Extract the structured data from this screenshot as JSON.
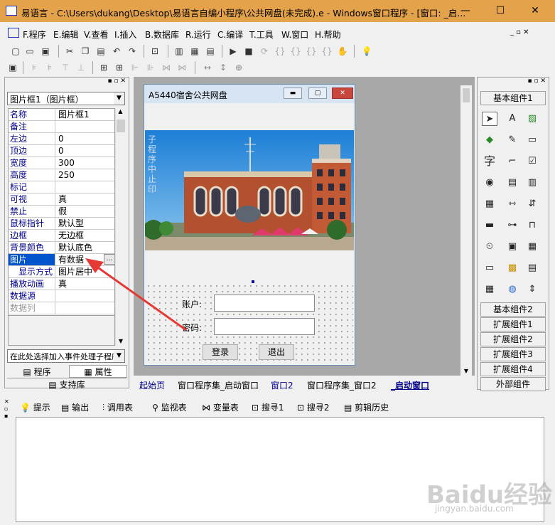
{
  "titlebar": {
    "title": "易语言 - C:\\Users\\dukang\\Desktop\\易语言自编小程序\\公共网盘(未完成).e - Windows窗口程序 - [窗口: _启...",
    "minimize": "—",
    "maximize": "☐",
    "close": "✕"
  },
  "menu": {
    "items": [
      {
        "label": "F.程序"
      },
      {
        "label": "E.编辑"
      },
      {
        "label": "V.查看"
      },
      {
        "label": "I.插入"
      },
      {
        "label": "B.数据库"
      },
      {
        "label": "R.运行"
      },
      {
        "label": "C.编译"
      },
      {
        "label": "T.工具"
      },
      {
        "label": "W.窗口"
      },
      {
        "label": "H.帮助"
      }
    ]
  },
  "left": {
    "object_selector": "图片框1（图片框）",
    "properties": [
      {
        "key": "名称",
        "value": "图片框1"
      },
      {
        "key": "备注",
        "value": ""
      },
      {
        "key": "左边",
        "value": "0"
      },
      {
        "key": "顶边",
        "value": "0"
      },
      {
        "key": "宽度",
        "value": "300"
      },
      {
        "key": "高度",
        "value": "250"
      },
      {
        "key": "标记",
        "value": ""
      },
      {
        "key": "可视",
        "value": "真"
      },
      {
        "key": "禁止",
        "value": "假"
      },
      {
        "key": "鼠标指针",
        "value": "默认型"
      },
      {
        "key": "边框",
        "value": "无边框"
      },
      {
        "key": "背景颜色",
        "value": "默认底色"
      },
      {
        "key": "图片",
        "value": "有数据"
      },
      {
        "key": "显示方式",
        "value": "图片居中"
      },
      {
        "key": "播放动画",
        "value": "真"
      },
      {
        "key": "数据源",
        "value": ""
      },
      {
        "key": "数据列",
        "value": ""
      }
    ],
    "event_selector": "在此处选择加入事件处理子程序",
    "tab_program": "程序",
    "tab_property": "属性",
    "tab_support": "支持库"
  },
  "form": {
    "title": "A5440宿舍公共网盘",
    "photo_text": "子程序中止印",
    "account_label": "账户:",
    "password_label": "密码:",
    "login_button": "登录",
    "exit_button": "退出"
  },
  "window_tabs": [
    {
      "label": "起始页"
    },
    {
      "label": "窗口程序集_启动窗口"
    },
    {
      "label": "窗口2"
    },
    {
      "label": "窗口程序集_窗口2"
    },
    {
      "label": "_启动窗口"
    }
  ],
  "right": {
    "basic": "基本组件1",
    "buttons": [
      "基本组件2",
      "扩展组件1",
      "扩展组件2",
      "扩展组件3",
      "扩展组件4",
      "外部组件"
    ]
  },
  "bottom": {
    "tabs": [
      {
        "label": "提示"
      },
      {
        "label": "输出"
      },
      {
        "label": "调用表"
      },
      {
        "label": "监视表"
      },
      {
        "label": "变量表"
      },
      {
        "label": "搜寻1"
      },
      {
        "label": "搜寻2"
      },
      {
        "label": "剪辑历史"
      }
    ]
  },
  "watermark": {
    "text": "Baidu经验",
    "sub": "jingyan.baidu.com"
  },
  "colors": {
    "titlebar": "#e4a24b",
    "selection": "#0055cc",
    "arrow": "#e53935"
  }
}
